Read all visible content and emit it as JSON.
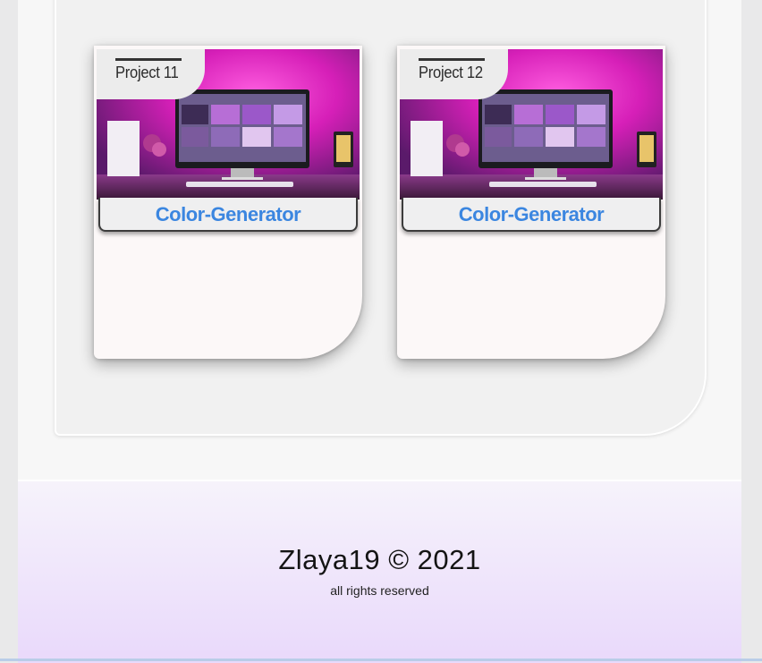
{
  "projects": [
    {
      "label": "Project 11",
      "title": "Color-Generator",
      "image_icon": "desk-setup-image"
    },
    {
      "label": "Project 12",
      "title": "Color-Generator",
      "image_icon": "desk-setup-image"
    }
  ],
  "footer": {
    "title": "Zlaya19 © 2021",
    "subtitle": "all rights reserved"
  },
  "colors": {
    "title_link": "#3b86e0",
    "footer_gradient_top": "#f6f3fb",
    "footer_gradient_bottom": "#e9d9fb",
    "image_glow": "#ff3cd6"
  }
}
